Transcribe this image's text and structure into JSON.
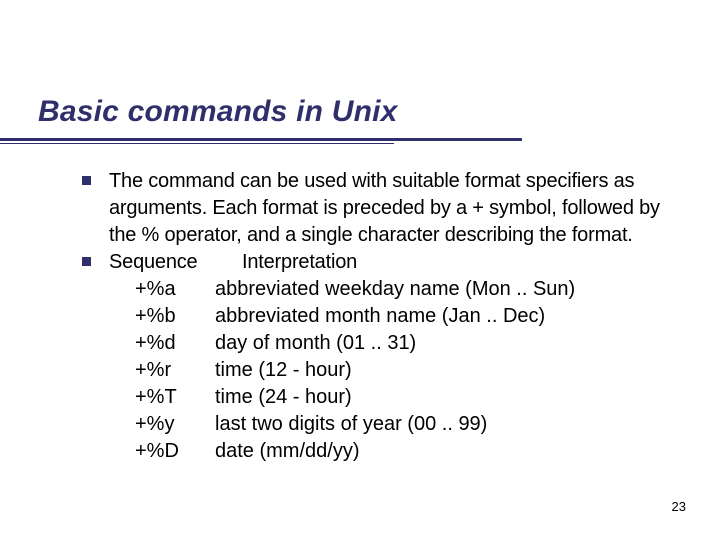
{
  "title": "Basic commands in Unix",
  "para1": "The command can be used with suitable format specifiers as arguments.  Each format is preceded by a + symbol, followed by the % operator, and a single character describing the format.",
  "header": {
    "seq": "Sequence",
    "interp": "Interpretation"
  },
  "rows": [
    {
      "seq": "+%a",
      "interp": "abbreviated weekday name (Mon .. Sun)"
    },
    {
      "seq": "+%b",
      "interp": "abbreviated month name (Jan .. Dec)"
    },
    {
      "seq": "+%d",
      "interp": "day of month (01 .. 31)"
    },
    {
      "seq": "+%r",
      "interp": "time (12 - hour)"
    },
    {
      "seq": "+%T",
      "interp": "time (24 - hour)"
    },
    {
      "seq": "+%y",
      "interp": "last two digits of year (00 .. 99)"
    },
    {
      "seq": "+%D",
      "interp": "date (mm/dd/yy)"
    }
  ],
  "page_number": "23"
}
